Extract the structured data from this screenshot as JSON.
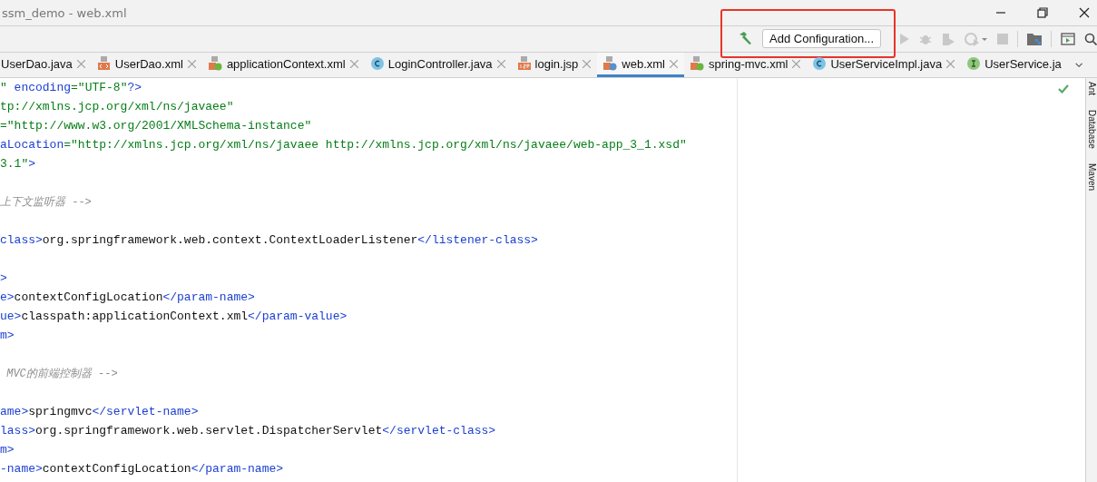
{
  "window": {
    "title": "ssm_demo - web.xml"
  },
  "toolbar": {
    "configuration_button": "Add Configuration..."
  },
  "tabs": [
    {
      "label": "UserDao.java",
      "kind": "plain",
      "selected": false,
      "closable": true
    },
    {
      "label": "UserDao.xml",
      "kind": "xml",
      "selected": false,
      "closable": true
    },
    {
      "label": "applicationContext.xml",
      "kind": "spring",
      "selected": false,
      "closable": true
    },
    {
      "label": "LoginController.java",
      "kind": "class",
      "selected": false,
      "closable": true
    },
    {
      "label": "login.jsp",
      "kind": "jsp",
      "selected": false,
      "closable": true
    },
    {
      "label": "web.xml",
      "kind": "web",
      "selected": true,
      "closable": true
    },
    {
      "label": "spring-mvc.xml",
      "kind": "spring",
      "selected": false,
      "closable": true
    },
    {
      "label": "UserServiceImpl.java",
      "kind": "class",
      "selected": false,
      "closable": true
    },
    {
      "label": "UserService.ja",
      "kind": "interface",
      "selected": false,
      "closable": false
    }
  ],
  "tool_windows": [
    "Ant",
    "Database",
    "Maven"
  ],
  "code_lines": [
    {
      "kind": "code",
      "segments": [
        {
          "kind": "string",
          "text": "\""
        },
        {
          "kind": "attr",
          "text": " encoding"
        },
        {
          "kind": "string",
          "text": "=\"UTF-8\""
        },
        {
          "kind": "tag",
          "text": "?>"
        }
      ]
    },
    {
      "kind": "code",
      "segments": [
        {
          "kind": "string",
          "text": "tp://xmlns.jcp.org/xml/ns/javaee\""
        }
      ]
    },
    {
      "kind": "code",
      "segments": [
        {
          "kind": "string",
          "text": "=\"http://www.w3.org/2001/XMLSchema-instance\""
        }
      ]
    },
    {
      "kind": "code",
      "segments": [
        {
          "kind": "attr",
          "text": "aLocation"
        },
        {
          "kind": "string",
          "text": "=\"http://xmlns.jcp.org/xml/ns/javaee http://xmlns.jcp.org/xml/ns/javaee/web-app_3_1.xsd\""
        }
      ]
    },
    {
      "kind": "code",
      "segments": [
        {
          "kind": "string",
          "text": "3.1\""
        },
        {
          "kind": "tag",
          "text": ">"
        }
      ]
    },
    {
      "kind": "blank"
    },
    {
      "kind": "code",
      "segments": [
        {
          "kind": "comment",
          "text": "上下文监听器 -->"
        }
      ]
    },
    {
      "kind": "blank"
    },
    {
      "kind": "code",
      "segments": [
        {
          "kind": "tag",
          "text": "class>"
        },
        {
          "kind": "text",
          "text": "org.springframework.web.context.ContextLoaderListener"
        },
        {
          "kind": "tag",
          "text": "</listener-class>"
        }
      ]
    },
    {
      "kind": "blank"
    },
    {
      "kind": "code",
      "segments": [
        {
          "kind": "tag",
          "text": ">"
        }
      ]
    },
    {
      "kind": "code",
      "segments": [
        {
          "kind": "tag",
          "text": "e>"
        },
        {
          "kind": "text",
          "text": "contextConfigLocation"
        },
        {
          "kind": "tag",
          "text": "</param-name>"
        }
      ]
    },
    {
      "kind": "code",
      "segments": [
        {
          "kind": "tag",
          "text": "ue>"
        },
        {
          "kind": "text",
          "text": "classpath:applicationContext.xml"
        },
        {
          "kind": "tag",
          "text": "</param-value>"
        }
      ]
    },
    {
      "kind": "code",
      "segments": [
        {
          "kind": "tag",
          "text": "m>"
        }
      ]
    },
    {
      "kind": "blank"
    },
    {
      "kind": "code",
      "segments": [
        {
          "kind": "comment",
          "text": " MVC的前端控制器 -->"
        }
      ]
    },
    {
      "kind": "blank"
    },
    {
      "kind": "code",
      "segments": [
        {
          "kind": "tag",
          "text": "ame>"
        },
        {
          "kind": "text",
          "text": "springmvc"
        },
        {
          "kind": "tag",
          "text": "</servlet-name>"
        }
      ]
    },
    {
      "kind": "code",
      "segments": [
        {
          "kind": "tag",
          "text": "lass>"
        },
        {
          "kind": "text",
          "text": "org.springframework.web.servlet.DispatcherServlet"
        },
        {
          "kind": "tag",
          "text": "</servlet-class>"
        }
      ]
    },
    {
      "kind": "code",
      "segments": [
        {
          "kind": "tag",
          "text": "m>"
        }
      ]
    },
    {
      "kind": "code",
      "segments": [
        {
          "kind": "tag",
          "text": "-name>"
        },
        {
          "kind": "text",
          "text": "contextConfigLocation"
        },
        {
          "kind": "tag",
          "text": "</param-name>"
        }
      ]
    }
  ]
}
